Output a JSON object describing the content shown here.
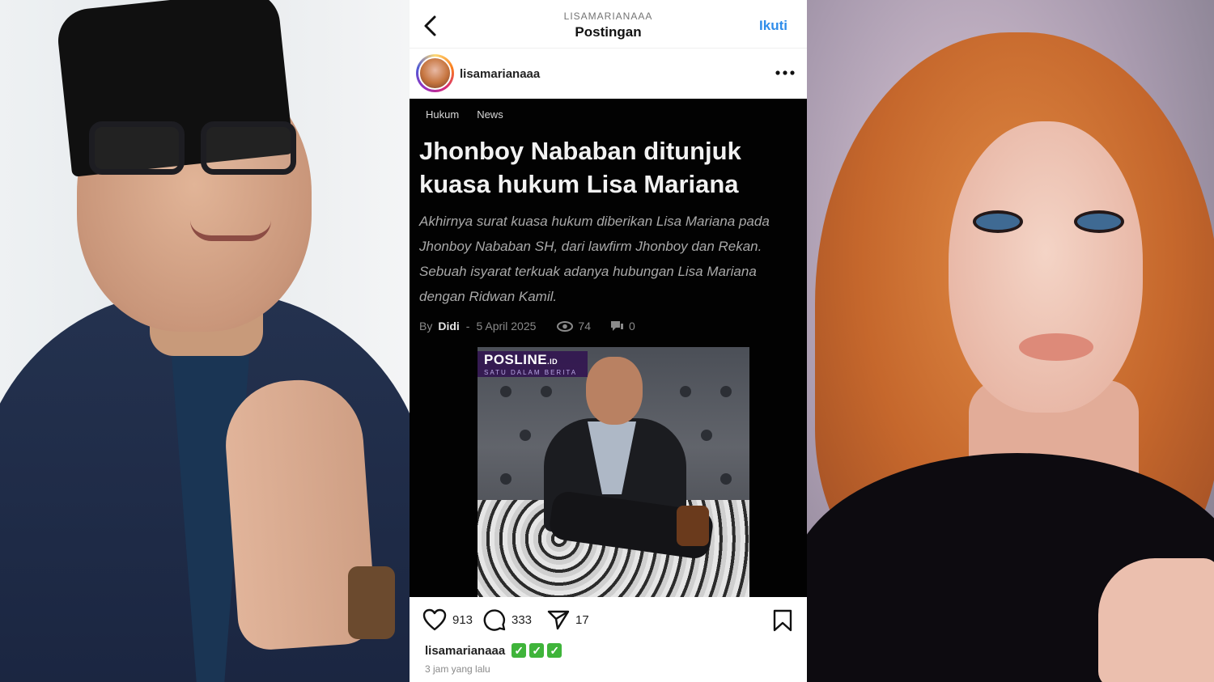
{
  "top_bar": {
    "account": "LISAMARIANAAA",
    "title": "Postingan",
    "follow_label": "Ikuti"
  },
  "post": {
    "username": "lisamarianaaa",
    "article": {
      "categories": [
        "Hukum",
        "News"
      ],
      "headline": "Jhonboy Nababan ditunjuk kuasa hukum Lisa Mariana",
      "lede": "Akhirnya surat kuasa hukum diberikan Lisa Mariana pada Jhonboy Nababan SH, dari lawfirm Jhonboy dan Rekan. Sebuah isyarat terkuak adanya hubungan Lisa Mariana dengan Ridwan Kamil.",
      "by_label": "By",
      "author": "Didi",
      "separator": "-",
      "date": "5 April 2025",
      "views": "74",
      "comments": "0",
      "photo_brand": "POSLINE",
      "photo_brand_suffix": ".ID",
      "photo_tagline": "SATU DALAM BERITA"
    },
    "likes": "913",
    "comments": "333",
    "shares": "17",
    "caption_user": "lisamarianaaa",
    "caption_checks": [
      "✓",
      "✓",
      "✓"
    ],
    "timestamp": "3 jam yang lalu"
  },
  "colors": {
    "follow": "#2f8dea",
    "article_bg": "#020202",
    "check": "#3fb43a"
  }
}
